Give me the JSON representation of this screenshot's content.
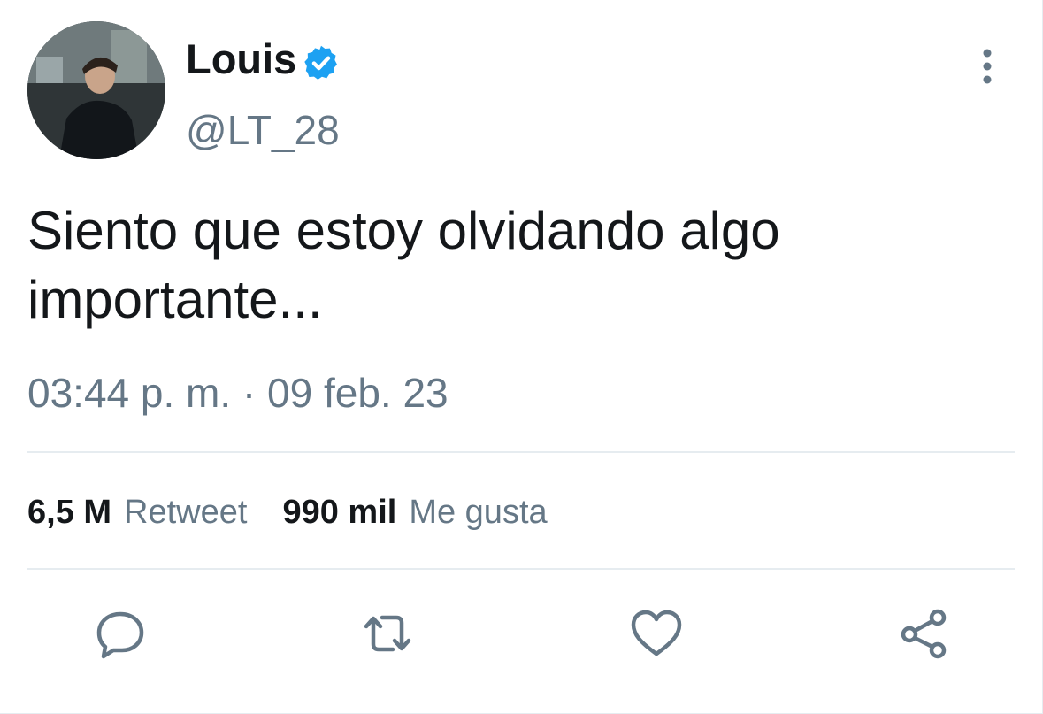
{
  "tweet": {
    "author": {
      "display_name": "Louis",
      "handle": "@LT_28",
      "verified": true
    },
    "text": "Siento que estoy olvidando algo importante...",
    "timestamp": "03:44 p. m. · 09 feb. 23",
    "stats": {
      "retweets_count": "6,5 M",
      "retweets_label": "Retweet",
      "likes_count": "990 mil",
      "likes_label": "Me gusta"
    },
    "actions": [
      "reply-icon",
      "retweet-icon",
      "like-icon",
      "share-icon"
    ]
  },
  "colors": {
    "text_primary": "#14171a",
    "text_secondary": "#657786",
    "verified_blue": "#1da1f2",
    "divider": "#e6ecf0"
  }
}
